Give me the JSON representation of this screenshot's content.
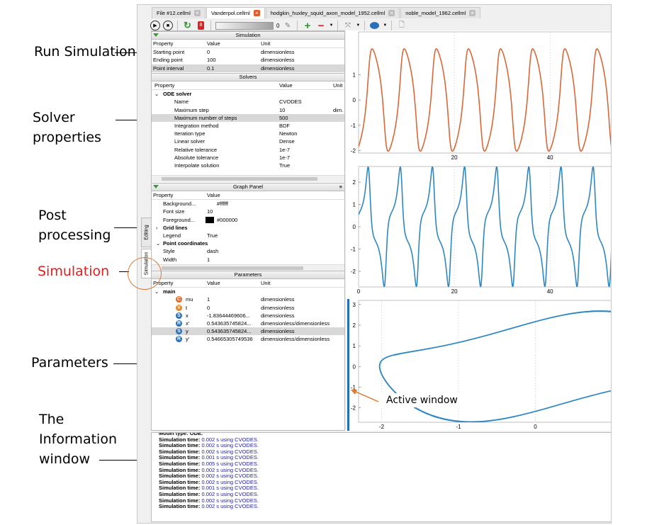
{
  "annotations": {
    "run": "Run Simulation",
    "solver": "Solver properties",
    "post": "Post processing",
    "simulation": "Simulation",
    "parameters": "Parameters",
    "info": "The Information window",
    "active": "Active window"
  },
  "tabs": [
    {
      "label": "File #12.cellml",
      "active": false
    },
    {
      "label": "Vanderpol.cellml",
      "active": true
    },
    {
      "label": "hodgkin_huxley_squid_axon_model_1952.cellml",
      "active": false
    },
    {
      "label": "noble_model_1962.cellml",
      "active": false
    }
  ],
  "toolbar": {
    "slider_value": "0",
    "add": "+",
    "remove": "−",
    "red_label": "8"
  },
  "side_tabs": {
    "editing": "Editing",
    "simulation": "Simulation"
  },
  "simulation": {
    "title": "Simulation",
    "headers": [
      "Property",
      "Value",
      "Unit"
    ],
    "rows": [
      {
        "p": "Starting point",
        "v": "0",
        "u": "dimensionless"
      },
      {
        "p": "Ending point",
        "v": "100",
        "u": "dimensionless"
      },
      {
        "p": "Point interval",
        "v": "0.1",
        "u": "dimensionless"
      }
    ]
  },
  "solvers": {
    "title": "Solvers",
    "headers": [
      "Property",
      "Value",
      "Unit"
    ],
    "group": "ODE solver",
    "rows": [
      {
        "p": "Name",
        "v": "CVODES",
        "u": ""
      },
      {
        "p": "Maximum step",
        "v": "10",
        "u": "dim."
      },
      {
        "p": "Maximum number of steps",
        "v": "500",
        "u": ""
      },
      {
        "p": "Integration method",
        "v": "BDF",
        "u": ""
      },
      {
        "p": "Iteration type",
        "v": "Newton",
        "u": ""
      },
      {
        "p": "Linear solver",
        "v": "Dense",
        "u": ""
      },
      {
        "p": "Relative tolerance",
        "v": "1e-7",
        "u": ""
      },
      {
        "p": "Absolute tolerance",
        "v": "1e-7",
        "u": ""
      },
      {
        "p": "Interpolate solution",
        "v": "True",
        "u": ""
      }
    ]
  },
  "graph_panel": {
    "title": "Graph Panel",
    "headers": [
      "Property",
      "Value"
    ],
    "rows": [
      {
        "p": "Background...",
        "v": "#ffffff"
      },
      {
        "p": "Font size",
        "v": "10"
      },
      {
        "p": "Foreground...",
        "v": "#000000"
      },
      {
        "p": "Grid lines",
        "v": ""
      },
      {
        "p": "Legend",
        "v": "True"
      },
      {
        "p": "Point coordinates",
        "v": ""
      },
      {
        "p": "Style",
        "v": "dash"
      },
      {
        "p": "Width",
        "v": "1"
      }
    ]
  },
  "parameters": {
    "title": "Parameters",
    "headers": [
      "Property",
      "Value",
      "Unit"
    ],
    "group": "main",
    "rows": [
      {
        "badge": "C",
        "color": "#e06a2b",
        "p": "mu",
        "v": "1",
        "u": "dimensionless"
      },
      {
        "badge": "V",
        "color": "#e08a2b",
        "p": "t",
        "v": "0",
        "u": "dimensionless"
      },
      {
        "badge": "S",
        "color": "#2a6fb8",
        "p": "x",
        "v": "-1.83644469606...",
        "u": "dimensionless"
      },
      {
        "badge": "R",
        "color": "#2a6fb8",
        "p": "x'",
        "v": "0.543635745824...",
        "u": "dimensionless/dimensionless"
      },
      {
        "badge": "S",
        "color": "#2a6fb8",
        "p": "y",
        "v": "0.543635745824...",
        "u": "dimensionless"
      },
      {
        "badge": "R",
        "color": "#2a6fb8",
        "p": "y'",
        "v": "0.54665305749536",
        "u": "dimensionless/dimensionless"
      }
    ]
  },
  "info": {
    "first": "Model type: ODE.",
    "label": "Simulation time:",
    "lines": [
      {
        "t": "0.002 s",
        "s": "using CVODES."
      },
      {
        "t": "0.002 s",
        "s": "using CVODES."
      },
      {
        "t": "0.002 s",
        "s": "using CVODES."
      },
      {
        "t": "0.001 s",
        "s": "using CVODES."
      },
      {
        "t": "0.005 s",
        "s": "using CVODES."
      },
      {
        "t": "0.002 s",
        "s": "using CVODES."
      },
      {
        "t": "0.002 s",
        "s": "using CVODES."
      },
      {
        "t": "0.002 s",
        "s": "using CVODES."
      },
      {
        "t": "0.001 s",
        "s": "using CVODES."
      },
      {
        "t": "0.002 s",
        "s": "using CVODES."
      },
      {
        "t": "0.002 s",
        "s": "using CVODES."
      },
      {
        "t": "0.002 s",
        "s": "using CVODES."
      }
    ]
  },
  "chart_data": [
    {
      "type": "line",
      "series": [
        {
          "values": "x(t) oscillation, period ~6.6",
          "color": "#d9673a"
        }
      ],
      "xticks": [
        "20",
        "40"
      ],
      "yticks": [
        "1",
        "0",
        "-1",
        "-2"
      ],
      "xlim": [
        0,
        53
      ],
      "ylim": [
        -2.1,
        2.7
      ]
    },
    {
      "type": "line",
      "series": [
        {
          "values": "y(t) oscillation, period ~6.6",
          "color": "#2f87c2"
        }
      ],
      "xticks": [
        "0",
        "20",
        "40"
      ],
      "yticks": [
        "2",
        "1",
        "0",
        "-1",
        "-2"
      ],
      "xlim": [
        0,
        53
      ],
      "ylim": [
        -2.7,
        2.7
      ]
    },
    {
      "type": "line",
      "series": [
        {
          "values": "phase portrait y vs x",
          "color": "#2f87c2"
        }
      ],
      "xticks": [
        "-2",
        "-1",
        "0"
      ],
      "yticks": [
        "3",
        "2",
        "1",
        "0",
        "-1",
        "-2"
      ],
      "xlim": [
        -2.3,
        1.0
      ],
      "ylim": [
        -2.7,
        3.2
      ]
    }
  ]
}
